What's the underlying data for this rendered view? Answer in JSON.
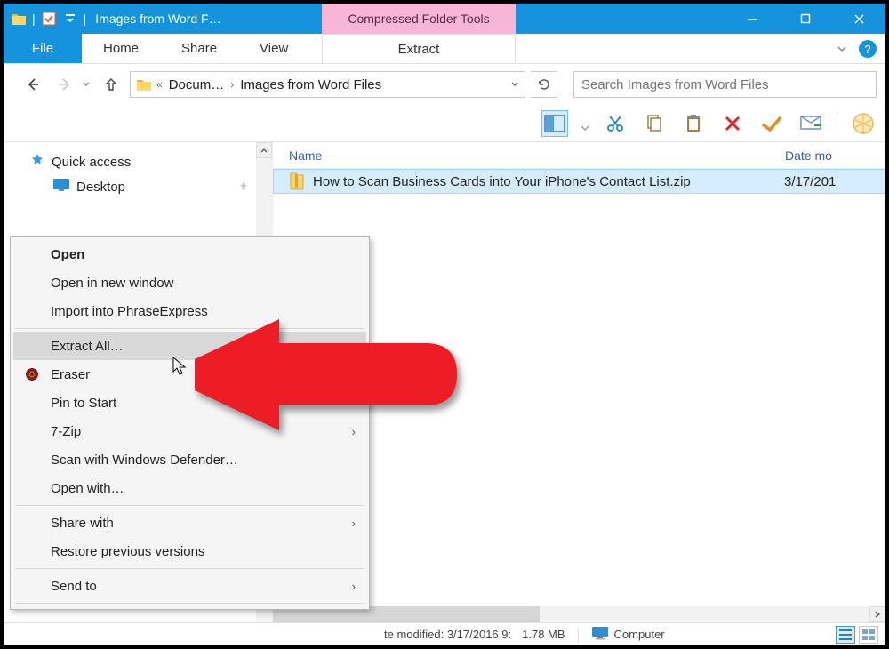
{
  "titlebar": {
    "title": "Images from Word F…",
    "compressed_tools": "Compressed Folder Tools"
  },
  "ribbon": {
    "file": "File",
    "home": "Home",
    "share": "Share",
    "view": "View",
    "extract": "Extract"
  },
  "address": {
    "seg1": "Docum…",
    "seg2": "Images from Word Files"
  },
  "search": {
    "placeholder": "Search Images from Word Files"
  },
  "sidebar": {
    "quick_access": "Quick access",
    "desktop": "Desktop"
  },
  "columns": {
    "name": "Name",
    "date": "Date mo"
  },
  "file": {
    "name": "How to Scan Business Cards into Your iPhone's Contact List.zip",
    "date": "3/17/201"
  },
  "status": {
    "modified_label": "te modified:",
    "modified_value": "3/17/2016 9:",
    "size": "1.78 MB",
    "computer": "Computer"
  },
  "context_menu": {
    "open": "Open",
    "open_new": "Open in new window",
    "import_pe": "Import into PhraseExpress",
    "extract_all": "Extract All…",
    "eraser": "Eraser",
    "pin_start": "Pin to Start",
    "sevenzip": "7-Zip",
    "defender": "Scan with Windows Defender…",
    "open_with": "Open with…",
    "share_with": "Share with",
    "restore": "Restore previous versions",
    "send_to": "Send to"
  }
}
